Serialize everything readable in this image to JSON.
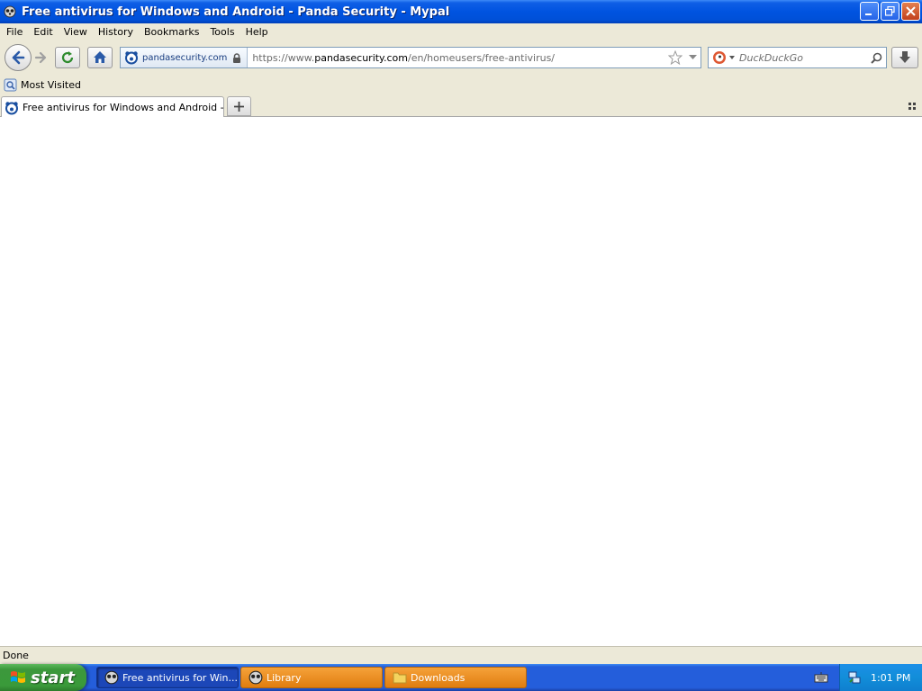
{
  "window": {
    "title": "Free antivirus for Windows and Android - Panda Security - Mypal"
  },
  "menu": [
    "File",
    "Edit",
    "View",
    "History",
    "Bookmarks",
    "Tools",
    "Help"
  ],
  "navbar": {
    "identity_domain": "pandasecurity.com",
    "url_prefix": "https://www.",
    "url_host": "pandasecurity.com",
    "url_path": "/en/homeusers/free-antivirus/",
    "search_placeholder": "DuckDuckGo"
  },
  "bookmarks": {
    "items": [
      "Most Visited"
    ]
  },
  "tabs": {
    "items": [
      {
        "title": "Free antivirus for Windows and Android - Pa..."
      }
    ]
  },
  "statusbar": {
    "text": "Done"
  },
  "taskbar": {
    "start_label": "start",
    "tasks": [
      {
        "label": "Free antivirus for Win..."
      },
      {
        "label": "Library"
      },
      {
        "label": "Downloads"
      }
    ],
    "clock": "1:01 PM"
  },
  "colors": {
    "titlebar_blue": "#0053e0",
    "chrome_beige": "#ece9d8",
    "taskbar_blue": "#245edb",
    "start_green": "#3c983c",
    "task_orange": "#e07d0f"
  }
}
